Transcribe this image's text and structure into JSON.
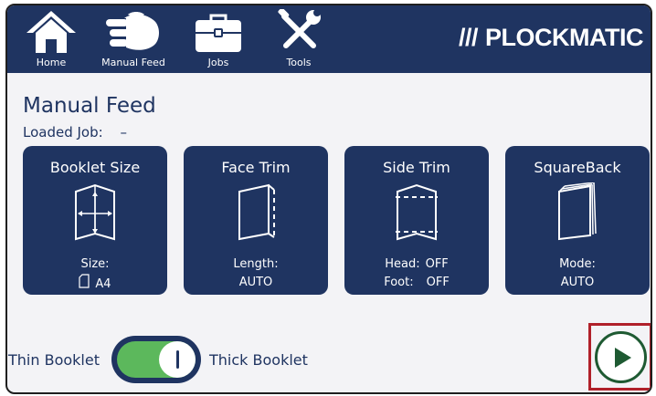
{
  "nav": {
    "home_label": "Home",
    "manual_feed_label": "Manual Feed",
    "jobs_label": "Jobs",
    "tools_label": "Tools"
  },
  "brand": {
    "name": "PLOCKMATIC",
    "slashes": "///"
  },
  "main": {
    "title": "Manual Feed",
    "loaded_job_label": "Loaded Job:",
    "loaded_job_value": "–"
  },
  "cards": {
    "booklet_size": {
      "title": "Booklet Size",
      "label": "Size:",
      "value": "A4"
    },
    "face_trim": {
      "title": "Face Trim",
      "label": "Length:",
      "value": "AUTO"
    },
    "side_trim": {
      "title": "Side Trim",
      "head_label": "Head:",
      "head_value": "OFF",
      "foot_label": "Foot:",
      "foot_value": "OFF"
    },
    "squareback": {
      "title": "SquareBack",
      "label": "Mode:",
      "value": "AUTO"
    }
  },
  "toggle": {
    "left_label": "Thin Booklet",
    "right_label": "Thick Booklet",
    "state": "thick"
  },
  "colors": {
    "navy": "#1f3461",
    "toggle_green": "#5cb85c",
    "play_green": "#1e5a32",
    "highlight_red": "#b0202a"
  },
  "icons": [
    "home-icon",
    "hand-icon",
    "briefcase-icon",
    "tools-icon",
    "play-icon"
  ]
}
